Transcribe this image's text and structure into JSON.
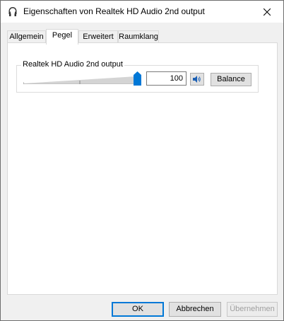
{
  "window": {
    "title": "Eigenschaften von Realtek HD Audio 2nd output",
    "title_icon": "speaker-properties-icon",
    "close_icon": "close-icon"
  },
  "tabs": [
    {
      "label": "Allgemein",
      "active": false
    },
    {
      "label": "Pegel",
      "active": true
    },
    {
      "label": "Erweitert",
      "active": false
    },
    {
      "label": "Raumklang",
      "active": false
    }
  ],
  "level_group": {
    "label": "Realtek HD Audio 2nd output",
    "value": "100",
    "slider_fraction": 1.0,
    "speaker_icon": "speaker-volume-icon",
    "balance_label": "Balance",
    "accent_color": "#0078d7"
  },
  "buttons": {
    "ok": "OK",
    "cancel": "Abbrechen",
    "apply": "Übernehmen"
  }
}
